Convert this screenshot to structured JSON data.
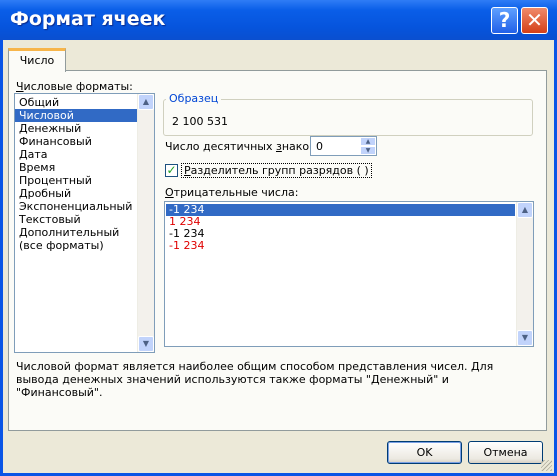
{
  "window": {
    "title": "Формат ячеек",
    "help_glyph": "?",
    "close_glyph": "✕"
  },
  "tabs": [
    {
      "label": "Число",
      "selected": true
    }
  ],
  "formats": {
    "label_prefix": "",
    "label_underlined": "Ч",
    "label_rest": "исловые форматы:",
    "items": [
      "Общий",
      "Числовой",
      "Денежный",
      "Финансовый",
      "Дата",
      "Время",
      "Процентный",
      "Дробный",
      "Экспоненциальный",
      "Текстовый",
      "Дополнительный",
      "(все форматы)"
    ],
    "selected_index": 1
  },
  "sample": {
    "title": "Образец",
    "value": "2 100 531"
  },
  "decimals": {
    "label_a": "Число десятичных ",
    "label_u": "з",
    "label_b": "наков:",
    "value": "0"
  },
  "separator": {
    "checked": true,
    "label_u": "Р",
    "label_rest": "азделитель групп разрядов ( )"
  },
  "negatives": {
    "label_u": "О",
    "label_rest": "трицательные числа:",
    "items": [
      {
        "text": "-1 234",
        "color": "#000000",
        "selected": true
      },
      {
        "text": "1 234",
        "color": "#e00000",
        "selected": false
      },
      {
        "text": "-1 234",
        "color": "#000000",
        "selected": false
      },
      {
        "text": "-1 234",
        "color": "#e00000",
        "selected": false
      }
    ]
  },
  "description": "Числовой формат является наиболее общим способом представления чисел. Для вывода денежных значений используются также форматы \"Денежный\" и \"Финансовый\".",
  "buttons": {
    "ok": "OK",
    "cancel": "Отмена"
  },
  "colors": {
    "title_bar": "#0a5ee8",
    "selection": "#316ac5",
    "negative_red": "#e00000",
    "group_title": "#0046d5"
  }
}
